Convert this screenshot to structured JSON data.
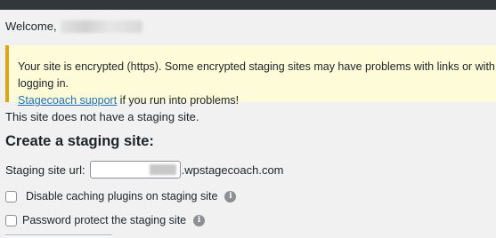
{
  "welcome": {
    "label": "Welcome,"
  },
  "notice": {
    "line1": "Your site is encrypted (https). Some encrypted staging sites may have problems with links or with logging in.",
    "link_text": "Stagecoach support",
    "line2_rest": " if you run into problems!"
  },
  "status_text": "This site does not have a staging site.",
  "create_heading": "Create a staging site:",
  "url_field": {
    "label": "Staging site url:",
    "suffix": ".wpstagecoach.com"
  },
  "options": [
    {
      "label": "Disable caching plugins on staging site",
      "checked": false
    },
    {
      "label": "Password protect the staging site",
      "checked": false
    }
  ],
  "icons": {
    "info": "info-icon"
  },
  "colors": {
    "admin_bar": "#32373c",
    "notice_bg": "#fefbd8",
    "notice_border": "#dba617",
    "link": "#2271b1"
  }
}
